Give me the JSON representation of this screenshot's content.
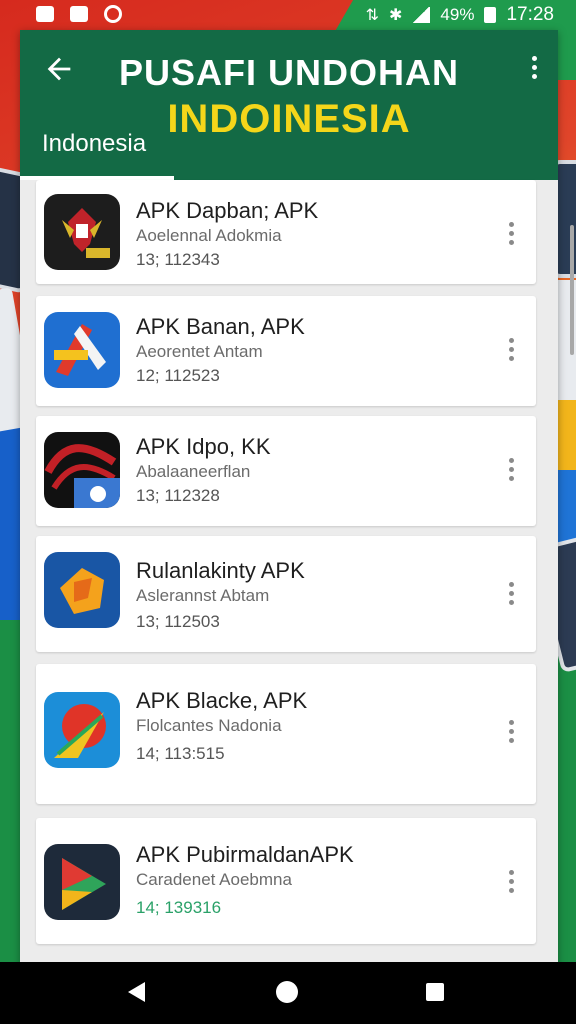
{
  "status": {
    "percent": "49%",
    "time": "17:28",
    "glyph1": "⇅",
    "glyph2": "✱"
  },
  "appbar": {
    "title_line1": "PUSAFI UNDOHAN",
    "title_line2": "INDOINESIA",
    "tab": "Indonesia"
  },
  "apps": [
    {
      "name": "APK Dapban; APK",
      "sub": "Aoelennal Adokmia",
      "ver": "13; 112343",
      "icon": "garuda-emblem-icon",
      "colors": [
        "#1d1d1d",
        "#c0232a",
        "#d9b62b"
      ]
    },
    {
      "name": "APK Banan, APK",
      "sub": "Aeorentet Antam",
      "ver": "12; 112523",
      "icon": "pencil-logo-icon",
      "colors": [
        "#1f6fd1",
        "#e03a2b",
        "#f4c21e"
      ]
    },
    {
      "name": "APK Idpo, KK",
      "sub": "Abalaaneerflan",
      "ver": "13; 112328",
      "icon": "wave-logo-icon",
      "colors": [
        "#111111",
        "#c22026",
        "#3a78d1"
      ]
    },
    {
      "name": "Rulanlakinty APK",
      "sub": "Aslerannst Abtam",
      "ver": "13; 112503",
      "icon": "orange-cube-icon",
      "colors": [
        "#1956a5",
        "#f4a21c",
        "#e56a19"
      ]
    },
    {
      "name": "APK Blacke, APK",
      "sub": "Flolcantes Nadonia",
      "ver": "14; 113:515",
      "icon": "globe-arrow-icon",
      "colors": [
        "#1c8ed8",
        "#e03428",
        "#f0c521"
      ]
    },
    {
      "name": "APK PubirmaldanAPK",
      "sub": "Caradenet Aoebmna",
      "ver": "14; 139316",
      "icon": "play-prism-icon",
      "colors": [
        "#1e2a3a",
        "#2fa45a",
        "#e03a33"
      ]
    }
  ]
}
